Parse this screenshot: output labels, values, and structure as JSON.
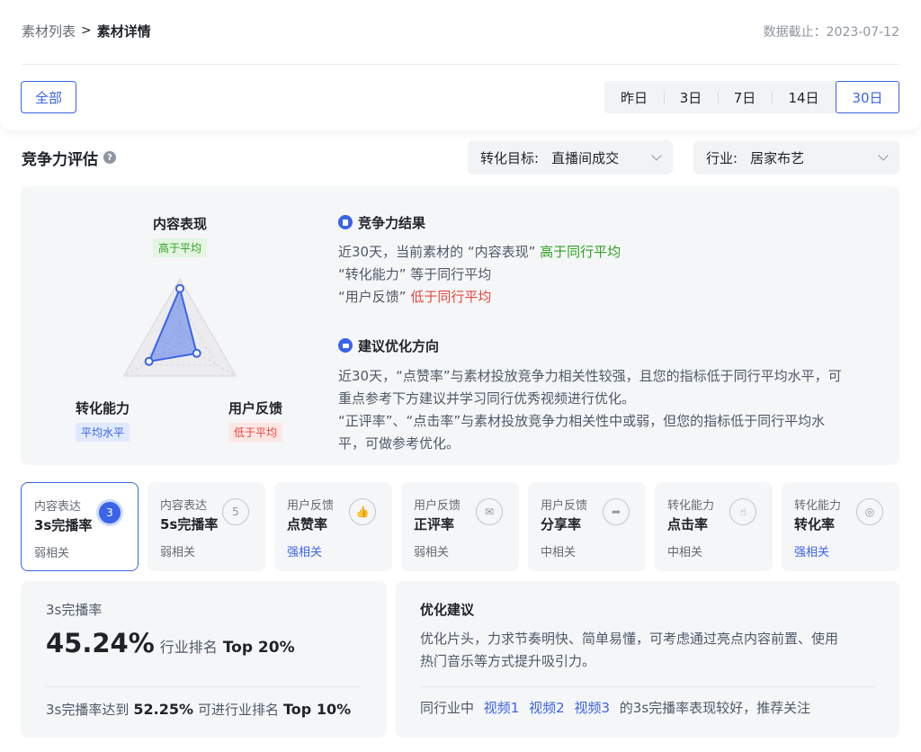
{
  "breadcrumb": {
    "parent": "素材列表",
    "separator": ">",
    "current": "素材详情"
  },
  "data_date": "数据截止：2023-07-12",
  "filter": {
    "all_label": "全部",
    "ranges": [
      {
        "label": "昨日",
        "active": false
      },
      {
        "label": "3日",
        "active": false
      },
      {
        "label": "7日",
        "active": false
      },
      {
        "label": "14日",
        "active": false
      },
      {
        "label": "30日",
        "active": true
      }
    ]
  },
  "section": {
    "title": "竞争力评估",
    "help_icon": "question-circle-icon",
    "conversion_select": {
      "label": "转化目标:",
      "value": "直播间成交"
    },
    "industry_select": {
      "label": "行业:",
      "value": "居家布艺"
    }
  },
  "radar": {
    "axes": [
      {
        "label": "内容表现",
        "tag": "高于平均",
        "tone": "green",
        "level": 0.85
      },
      {
        "label": "转化能力",
        "tag": "平均水平",
        "tone": "blue",
        "level": 0.55
      },
      {
        "label": "用户反馈",
        "tag": "低于平均",
        "tone": "red",
        "level": 0.3
      }
    ],
    "fill_color": "#3a63e8"
  },
  "result": {
    "title": "竞争力结果",
    "line1_prefix": "近30天，当前素材的 “内容表现” ",
    "line1_status": "高于同行平均",
    "line2": "“转化能力” 等于同行平均",
    "line3_prefix": "“用户反馈” ",
    "line3_status": "低于同行平均"
  },
  "advice": {
    "title": "建议优化方向",
    "p1_l1": "近30天，“点赞率”与素材投放竞争力相关性较强，且您的指标低于同行平均水平，可",
    "p1_l2": "重点参考下方建议并学习同行优秀视频进行优化。",
    "p2_l1": "“正评率”、“点击率”与素材投放竞争力相关性中或弱，但您的指标低于同行平均水",
    "p2_l2": "平，可做参考优化。"
  },
  "metrics": [
    {
      "category": "内容表达",
      "name": "3s完播率",
      "relevance": "弱相关",
      "icon": "play-3s-icon",
      "glyph": "3",
      "active": true,
      "strong": false
    },
    {
      "category": "内容表达",
      "name": "5s完播率",
      "relevance": "弱相关",
      "icon": "play-5s-icon",
      "glyph": "5",
      "active": false,
      "strong": false
    },
    {
      "category": "用户反馈",
      "name": "点赞率",
      "relevance": "强相关",
      "icon": "thumbs-up-icon",
      "glyph": "👍",
      "active": false,
      "strong": true
    },
    {
      "category": "用户反馈",
      "name": "正评率",
      "relevance": "弱相关",
      "icon": "comment-icon",
      "glyph": "✉",
      "active": false,
      "strong": false
    },
    {
      "category": "用户反馈",
      "name": "分享率",
      "relevance": "中相关",
      "icon": "share-icon",
      "glyph": "➦",
      "active": false,
      "strong": false
    },
    {
      "category": "转化能力",
      "name": "点击率",
      "relevance": "中相关",
      "icon": "click-icon",
      "glyph": "☝",
      "active": false,
      "strong": false
    },
    {
      "category": "转化能力",
      "name": "转化率",
      "relevance": "强相关",
      "icon": "conversion-icon",
      "glyph": "◎",
      "active": false,
      "strong": true
    }
  ],
  "detail": {
    "metric_name": "3s完播率",
    "value": "45.24%",
    "rank_label": "行业排名",
    "rank": "Top 20%",
    "goal_prefix": "3s完播率达到",
    "goal_value": "52.25%",
    "goal_mid": "可进行业排名",
    "goal_rank": "Top 10%"
  },
  "suggestion": {
    "title": "优化建议",
    "line1": "优化片头，力求节奏明快、简单易懂，可考虑通过亮点内容前置、使用",
    "line2": "热门音乐等方式提升吸引力。",
    "peer_prefix": "同行业中",
    "videos": [
      "视频1",
      "视频2",
      "视频3"
    ],
    "peer_suffix": "的3s完播率表现较好，推荐关注"
  }
}
